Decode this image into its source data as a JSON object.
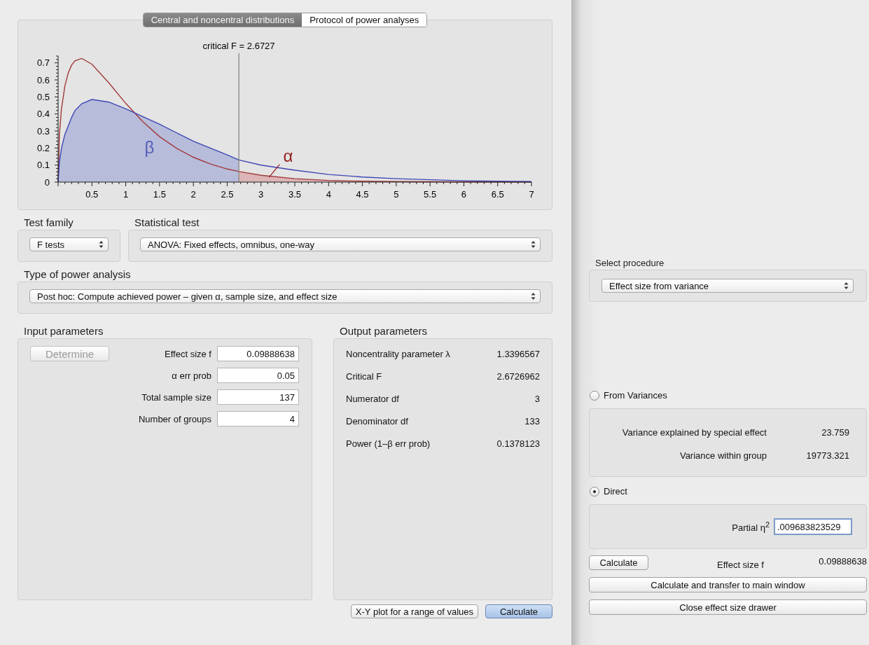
{
  "tabs": [
    {
      "label": "Central and noncentral distributions",
      "selected": true
    },
    {
      "label": "Protocol of power analyses",
      "selected": false
    }
  ],
  "chart_data": {
    "type": "line",
    "x": [
      0,
      0.02,
      0.05,
      0.1,
      0.15,
      0.2,
      0.25,
      0.35,
      0.5,
      0.75,
      1,
      1.25,
      1.5,
      1.75,
      2,
      2.25,
      2.5,
      2.6727,
      3,
      3.5,
      4,
      4.5,
      5,
      6,
      7
    ],
    "series": [
      {
        "color": "#a3393b",
        "values": [
          0,
          0.284,
          0.43,
          0.565,
          0.641,
          0.687,
          0.712,
          0.726,
          0.692,
          0.583,
          0.462,
          0.355,
          0.267,
          0.199,
          0.146,
          0.106,
          0.077,
          0.062,
          0.04,
          0.02,
          0.01,
          0.005,
          0.003,
          0.001,
          0
        ]
      },
      {
        "color": "#3d46b3",
        "values": [
          0,
          0.12,
          0.2,
          0.28,
          0.33,
          0.38,
          0.42,
          0.46,
          0.485,
          0.47,
          0.43,
          0.385,
          0.34,
          0.29,
          0.24,
          0.2,
          0.16,
          0.13,
          0.1,
          0.07,
          0.045,
          0.03,
          0.02,
          0.008,
          0.003
        ]
      }
    ],
    "xlim": [
      0,
      7
    ],
    "ylim": [
      0,
      0.74
    ],
    "xticks": [
      0.5,
      1,
      1.5,
      2,
      2.5,
      3,
      3.5,
      4,
      4.5,
      5,
      5.5,
      6,
      6.5,
      7
    ],
    "yticks": [
      0,
      0.1,
      0.2,
      0.3,
      0.4,
      0.5,
      0.6,
      0.7
    ],
    "ref_lines": [
      {
        "axis": "x",
        "value": 2.6727,
        "label": "critical F = 2.6727"
      }
    ],
    "annotations": [
      "β",
      "α"
    ]
  },
  "test_family": {
    "label": "Test family",
    "value": "F tests"
  },
  "statistical_test": {
    "label": "Statistical test",
    "value": "ANOVA: Fixed effects, omnibus, one-way"
  },
  "type_of_power_analysis": {
    "label": "Type of power analysis",
    "value": "Post hoc: Compute achieved power – given α, sample size, and effect size"
  },
  "input_parameters": {
    "title": "Input parameters",
    "determine_button": {
      "label": "Determine",
      "disabled": true
    },
    "fields": [
      {
        "label": "Effect size f",
        "value": "0.09888638"
      },
      {
        "label": "α err prob",
        "value": "0.05"
      },
      {
        "label": "Total sample size",
        "value": "137"
      },
      {
        "label": "Number of groups",
        "value": "4"
      }
    ]
  },
  "output_parameters": {
    "title": "Output parameters",
    "rows": [
      {
        "label": "Noncentrality parameter λ",
        "value": "1.3396567"
      },
      {
        "label": "Critical F",
        "value": "2.6726962"
      },
      {
        "label": "Numerator df",
        "value": "3"
      },
      {
        "label": "Denominator df",
        "value": "133"
      },
      {
        "label": "Power (1–β err prob)",
        "value": "0.1378123"
      }
    ]
  },
  "buttons": [
    {
      "label": "X-Y plot for a range of values",
      "default": false
    },
    {
      "label": "Calculate",
      "default": true
    }
  ],
  "drawer": {
    "select_procedure": {
      "label": "Select procedure",
      "value": "Effect size from variance"
    },
    "options": [
      {
        "label": "From Variances",
        "selected": false,
        "rows": [
          {
            "label": "Variance explained by special effect",
            "value": "23.759"
          },
          {
            "label": "Variance within group",
            "value": "19773.321"
          }
        ]
      },
      {
        "label": "Direct",
        "selected": true,
        "field": {
          "label": "Partial η$^{2}$",
          "value": ".009683823529"
        }
      }
    ],
    "calculate_button": "Calculate",
    "effect_size": {
      "label": "Effect size f",
      "value": "0.09888638"
    },
    "buttons": [
      "Calculate and transfer to main window",
      "Close effect size drawer"
    ]
  }
}
